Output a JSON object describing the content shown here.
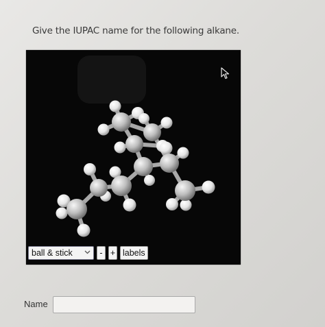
{
  "question": {
    "prompt": "Give the IUPAC name for the following alkane."
  },
  "viewer": {
    "render_mode": "ball & stick",
    "minus_label": "-",
    "plus_label": "+",
    "labels_label": "labels",
    "icons": [
      "pointer-cursor-icon",
      "chevron-down-icon"
    ]
  },
  "answer": {
    "label": "Name",
    "value": "",
    "placeholder": ""
  },
  "colors": {
    "page_bg": "#e2e1de",
    "viewer_bg": "#070707",
    "carbon": "#c4c4c4",
    "hydrogen": "#f2f2f2",
    "bond": "#a8a8a8"
  }
}
